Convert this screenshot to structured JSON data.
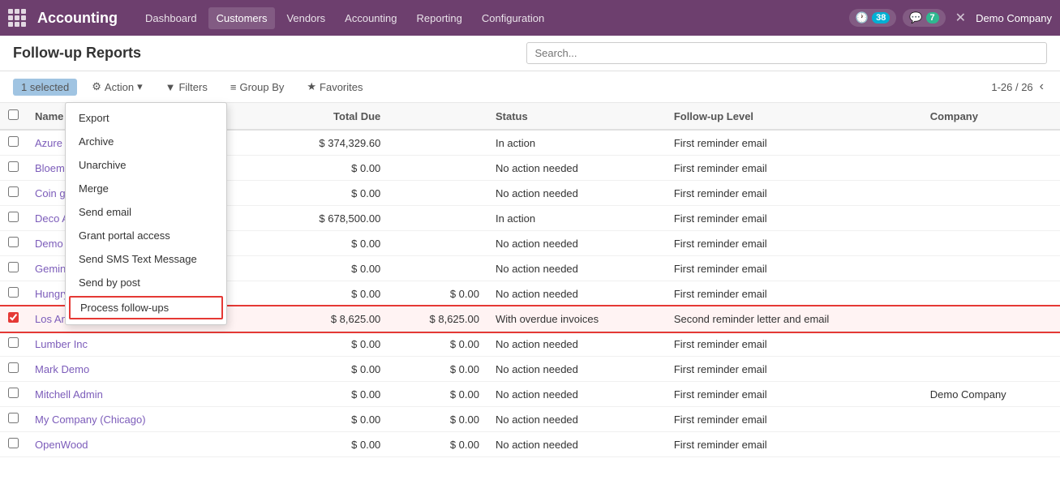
{
  "app": {
    "logo": "Accounting",
    "nav": [
      "Dashboard",
      "Customers",
      "Vendors",
      "Accounting",
      "Reporting",
      "Configuration"
    ],
    "active_nav": "Customers",
    "badge1": {
      "icon": "🕐",
      "count": "38"
    },
    "badge2": {
      "icon": "💬",
      "count": "7"
    },
    "company": "Demo Company"
  },
  "page": {
    "title": "Follow-up Reports",
    "search_placeholder": "Search...",
    "selected_label": "1 selected",
    "pagination": "1-26 / 26",
    "toolbar": {
      "action_label": "⚙ Action",
      "filters_label": "▼ Filters",
      "group_by_label": "≡ Group By",
      "favorites_label": "★ Favorites"
    },
    "dropdown": {
      "items": [
        "Export",
        "Archive",
        "Unarchive",
        "Merge",
        "Send email",
        "Grant portal access",
        "Send SMS Text Message",
        "Send by post",
        "Process follow-ups"
      ]
    },
    "table": {
      "headers": [
        "Name",
        "Total Due",
        "",
        "Status",
        "Follow-up Level",
        "Company"
      ],
      "rows": [
        {
          "name": "Azure Interior",
          "total_due": "$ 374,329.60",
          "overdue": "",
          "status": "In action",
          "followup": "First reminder email",
          "company": "",
          "selected": false
        },
        {
          "name": "Bloem GmbH",
          "total_due": "$ 0.00",
          "overdue": "",
          "status": "No action needed",
          "followup": "First reminder email",
          "company": "",
          "selected": false
        },
        {
          "name": "Coin gourmand",
          "total_due": "$ 0.00",
          "overdue": "",
          "status": "No action needed",
          "followup": "First reminder email",
          "company": "",
          "selected": false
        },
        {
          "name": "Deco Addict",
          "total_due": "$ 678,500.00",
          "overdue": "",
          "status": "In action",
          "followup": "First reminder email",
          "company": "",
          "selected": false
        },
        {
          "name": "Demo Company",
          "total_due": "$ 0.00",
          "overdue": "",
          "status": "No action needed",
          "followup": "First reminder email",
          "company": "",
          "selected": false
        },
        {
          "name": "Gemini Furniture",
          "total_due": "$ 0.00",
          "overdue": "",
          "status": "No action needed",
          "followup": "First reminder email",
          "company": "",
          "selected": false
        },
        {
          "name": "Hungry Dog",
          "total_due": "$ 0.00",
          "overdue": "$ 0.00",
          "status": "No action needed",
          "followup": "First reminder email",
          "company": "",
          "selected": false
        },
        {
          "name": "Los Angeles Convention Center",
          "total_due": "$ 8,625.00",
          "overdue": "$ 8,625.00",
          "status": "With overdue invoices",
          "followup": "Second reminder letter and email",
          "company": "",
          "selected": true
        },
        {
          "name": "Lumber Inc",
          "total_due": "$ 0.00",
          "overdue": "$ 0.00",
          "status": "No action needed",
          "followup": "First reminder email",
          "company": "",
          "selected": false
        },
        {
          "name": "Mark Demo",
          "total_due": "$ 0.00",
          "overdue": "$ 0.00",
          "status": "No action needed",
          "followup": "First reminder email",
          "company": "",
          "selected": false
        },
        {
          "name": "Mitchell Admin",
          "total_due": "$ 0.00",
          "overdue": "$ 0.00",
          "status": "No action needed",
          "followup": "First reminder email",
          "company": "Demo Company",
          "selected": false
        },
        {
          "name": "My Company (Chicago)",
          "total_due": "$ 0.00",
          "overdue": "$ 0.00",
          "status": "No action needed",
          "followup": "First reminder email",
          "company": "",
          "selected": false
        },
        {
          "name": "OpenWood",
          "total_due": "$ 0.00",
          "overdue": "$ 0.00",
          "status": "No action needed",
          "followup": "First reminder email",
          "company": "",
          "selected": false
        }
      ]
    }
  }
}
